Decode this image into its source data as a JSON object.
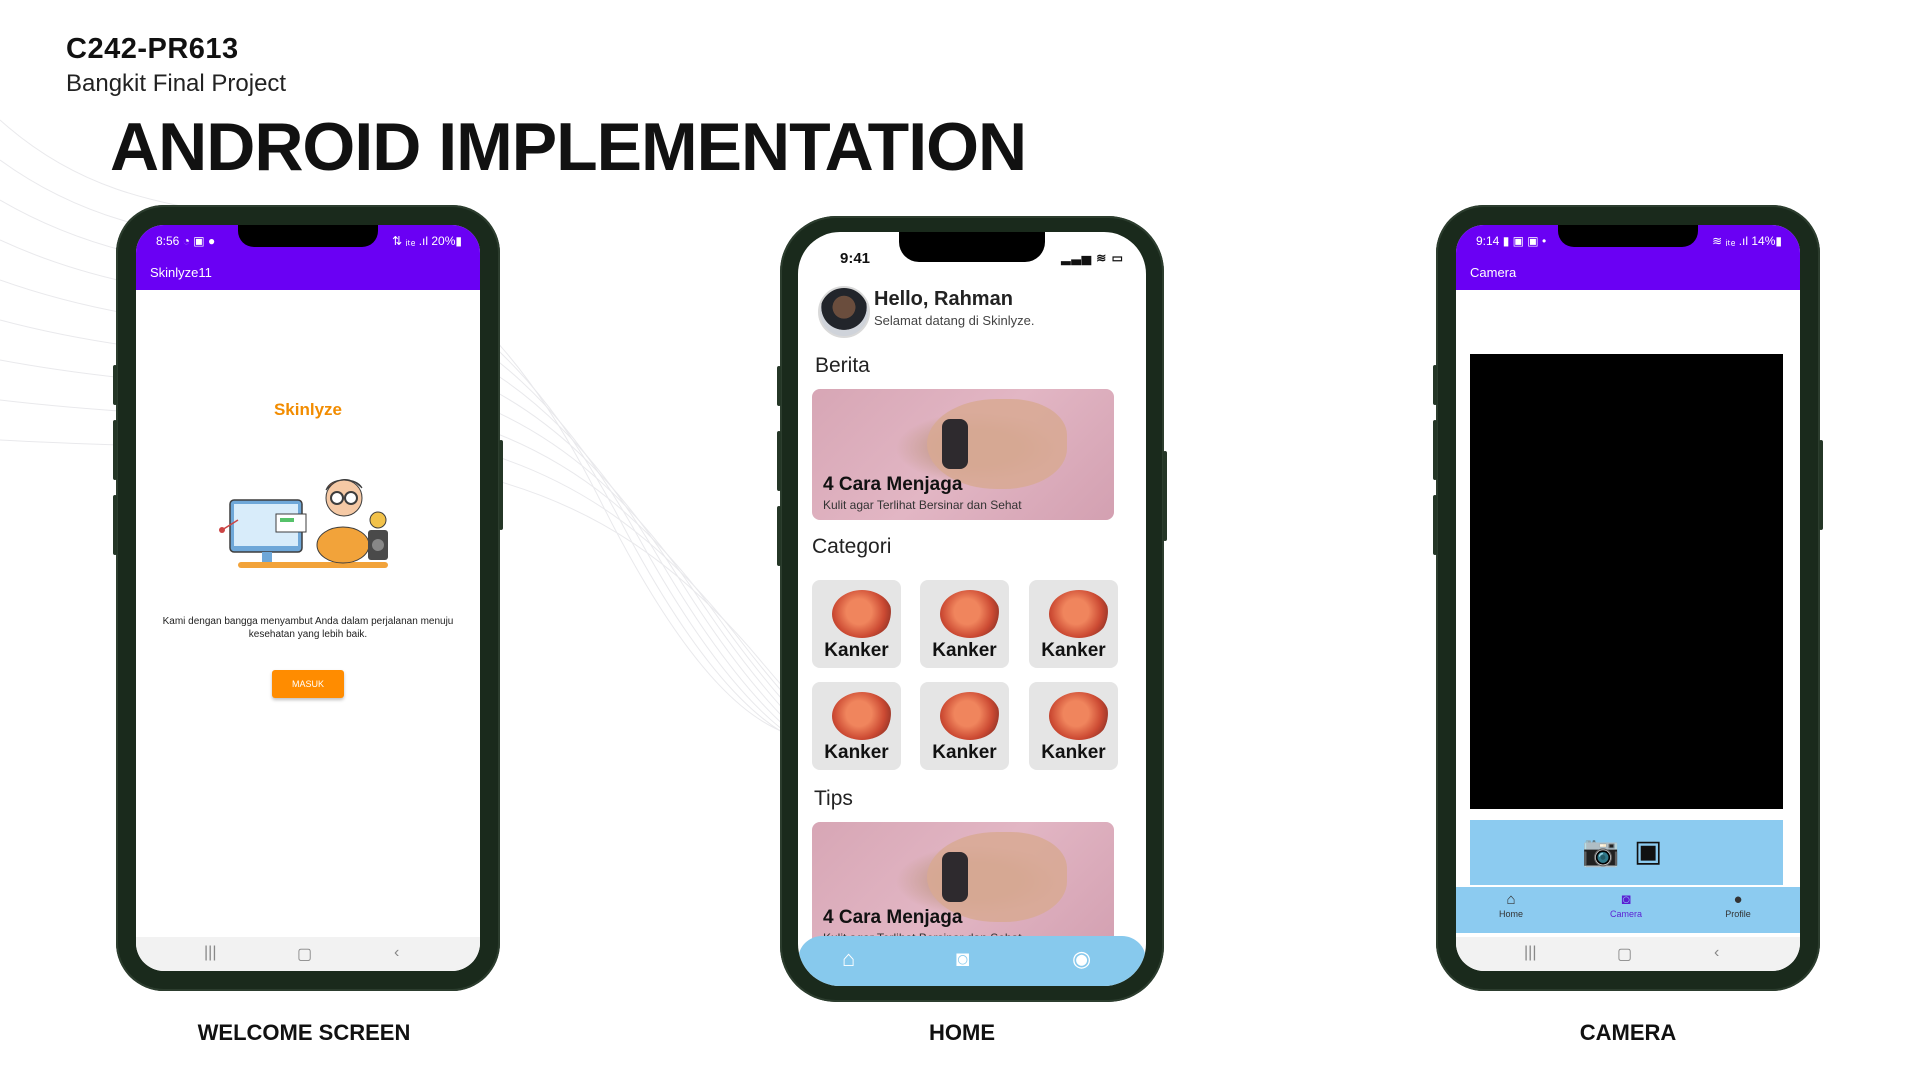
{
  "header": {
    "code": "C242-PR613",
    "subtitle": "Bangkit Final Project",
    "title": "ANDROID IMPLEMENTATION"
  },
  "captions": {
    "welcome": "WELCOME SCREEN",
    "home": "HOME",
    "camera": "CAMERA"
  },
  "welcome_screen": {
    "status_left": "8:56 ◔ ▣ ●",
    "status_right": "⇅ ᵢₜₑ .ıl 20%▮",
    "appbar_title": "Skinlyze11",
    "brand": "Skinlyze",
    "message": "Kami dengan bangga menyambut Anda dalam perjalanan menuju kesehatan yang lebih baik.",
    "button_label": "MASUK"
  },
  "home_screen": {
    "time": "9:41",
    "status_icons": "▂▃▅ ≋ ▭",
    "greeting": "Hello, Rahman",
    "greeting_sub": "Selamat datang di Skinlyze.",
    "section_berita": "Berita",
    "news_title": "4 Cara Menjaga",
    "news_sub": "Kulit agar Terlihat Bersinar dan Sehat",
    "section_categori": "Categori",
    "categories": [
      "Kanker",
      "Kanker",
      "Kanker",
      "Kanker",
      "Kanker",
      "Kanker"
    ],
    "section_tips": "Tips",
    "tips_title": "4 Cara Menjaga",
    "tips_sub": "Kulit agar Terlihat Bersinar dan Sehat"
  },
  "camera_screen": {
    "status_left": "9:14 ▮ ▣ ▣ •",
    "status_right": "≋ ᵢₜₑ .ıl 14%▮",
    "appbar_title": "Camera",
    "nav": [
      "Home",
      "Camera",
      "Profile"
    ]
  },
  "icons": {
    "home": "home-icon",
    "camera": "camera-icon",
    "profile": "profile-icon",
    "gallery": "gallery-icon"
  }
}
